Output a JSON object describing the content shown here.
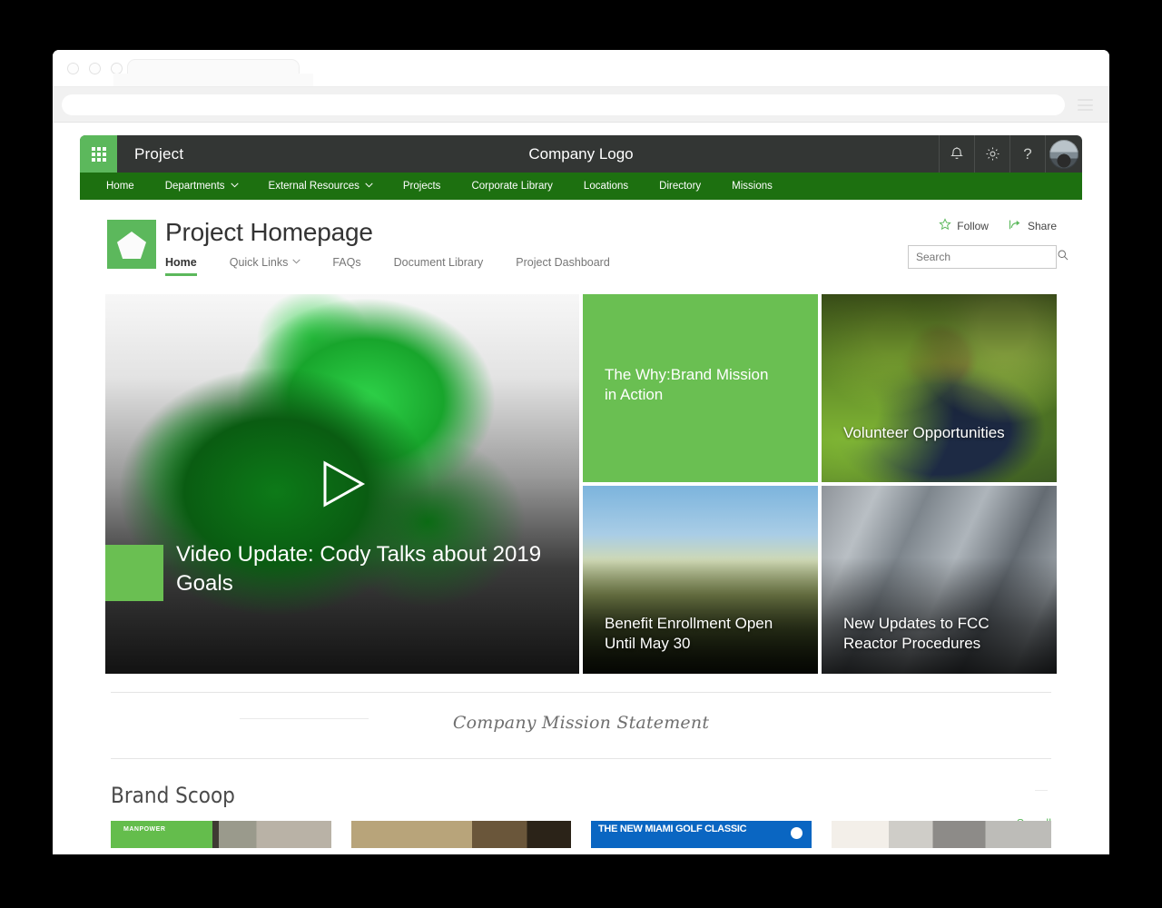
{
  "browser": {
    "traffic_lights": [
      "close",
      "minimize",
      "maximize"
    ],
    "tab_label": "",
    "url_value": "",
    "menu_icon": "hamburger-menu-icon"
  },
  "suitebar": {
    "waffle_icon": "app-launcher-waffle-icon",
    "app_name": "Project",
    "title": "Company Logo",
    "actions": [
      {
        "name": "notifications",
        "icon": "bell-icon",
        "label": ""
      },
      {
        "name": "settings",
        "icon": "gear-icon",
        "label": ""
      },
      {
        "name": "help",
        "icon": "question-mark-icon",
        "label": "?"
      }
    ],
    "avatar": "user-avatar"
  },
  "topnav": {
    "items": [
      {
        "label": "Home",
        "has_chevron": false
      },
      {
        "label": "Departments",
        "has_chevron": true
      },
      {
        "label": "External Resources",
        "has_chevron": true
      },
      {
        "label": "Projects",
        "has_chevron": false
      },
      {
        "label": "Corporate Library",
        "has_chevron": false
      },
      {
        "label": "Locations",
        "has_chevron": false
      },
      {
        "label": "Directory",
        "has_chevron": false
      },
      {
        "label": "Missions",
        "has_chevron": false
      }
    ]
  },
  "site": {
    "logo_icon": "pentagon-logo-icon",
    "title": "Project Homepage",
    "nav": [
      {
        "label": "Home",
        "active": true,
        "has_chevron": false
      },
      {
        "label": "Quick Links",
        "active": false,
        "has_chevron": true
      },
      {
        "label": "FAQs",
        "active": false,
        "has_chevron": false
      },
      {
        "label": "Document Library",
        "active": false,
        "has_chevron": false
      },
      {
        "label": "Project Dashboard",
        "active": false,
        "has_chevron": false
      }
    ],
    "follow_label": "Follow",
    "follow_icon": "star-outline-icon",
    "share_label": "Share",
    "share_icon": "share-arrow-icon",
    "search_placeholder": "Search",
    "search_value": "",
    "search_icon": "magnifier-icon"
  },
  "hero": {
    "video": {
      "title": "Video Update: Cody Talks about 2019 Goals",
      "play_icon": "play-triangle-icon",
      "badge": "green-accent-block"
    },
    "tiles": [
      {
        "name": "brand-mission",
        "title": "The Why:Brand Mission in Action",
        "style": "green"
      },
      {
        "name": "volunteer",
        "title": "Volunteer Opportunities",
        "style": "photo-boy"
      },
      {
        "name": "benefits",
        "title": "Benefit Enrollment Open Until May 30",
        "style": "photo-run"
      },
      {
        "name": "fcc-updates",
        "title": "New Updates to FCC Reactor Procedures",
        "style": "photo-pipe"
      }
    ]
  },
  "mission": {
    "text": "Company Mission Statement"
  },
  "scoop": {
    "title": "Brand Scoop",
    "see_all": "See all",
    "cards": [
      {
        "name": "manpower-card",
        "label": "MANPOWER"
      },
      {
        "name": "interior-card",
        "label": ""
      },
      {
        "name": "golf-classic-card",
        "label": "THE NEW MIAMI GOLF CLASSIC"
      },
      {
        "name": "equipment-card",
        "label": ""
      }
    ]
  },
  "colors": {
    "suitebar": "#333634",
    "topnav_green": "#1d7010",
    "accent_green": "#5cb85c",
    "tile_green": "#6abf52",
    "link_green": "#5cb85c"
  }
}
